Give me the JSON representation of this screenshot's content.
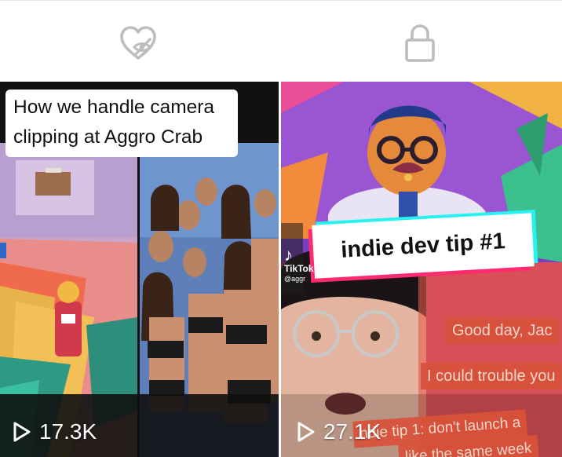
{
  "tabs": [
    {
      "icon": "liked-hidden-icon",
      "active": false
    },
    {
      "icon": "lock-icon",
      "active": false
    }
  ],
  "videos": [
    {
      "caption_lines": [
        "How we handle camera",
        "clipping at Aggro Crab"
      ],
      "views": "17.3K",
      "play_icon": "play-icon"
    },
    {
      "caption": "indie dev tip #1",
      "watermark": {
        "brand": "TikTok",
        "handle": "@aggr"
      },
      "dialogue": [
        "Good day, Jac",
        "I could trouble you",
        "ndie tip 1: don't launch a",
        "like the same week"
      ],
      "views": "27.1K",
      "play_icon": "play-icon"
    }
  ],
  "colors": {
    "icon_gray": "#bdbdbd",
    "caption_accent_pink": "#ff2b6e",
    "caption_accent_cyan": "#27f2f0",
    "dialogue_bg": "#d9523a"
  }
}
